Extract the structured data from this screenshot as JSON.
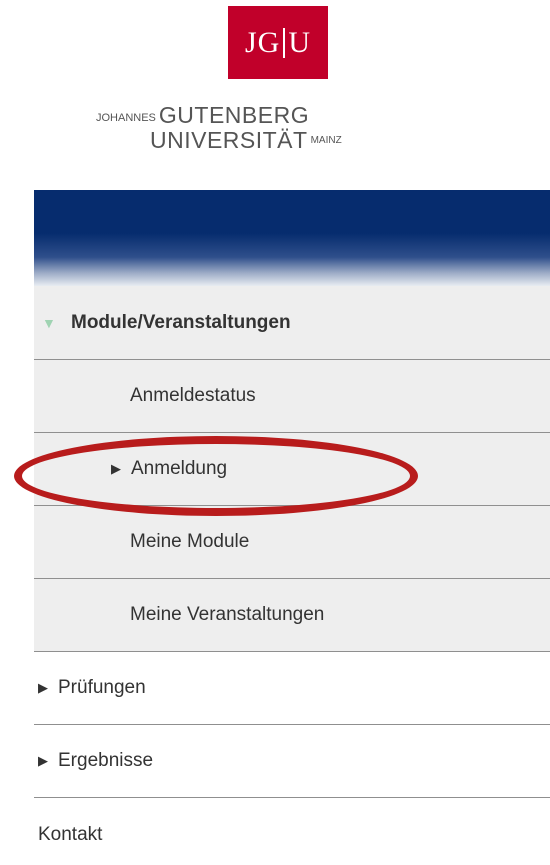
{
  "logo": {
    "mark_left": "JG",
    "mark_right": "U",
    "line1_prefix": "JOHANNES",
    "line1_main": "GUTENBERG",
    "line2_main": "UNIVERSITÄT",
    "line2_suffix": "MAINZ",
    "brand_color": "#c1002a"
  },
  "banner": {
    "color": "#062c6e"
  },
  "menu": {
    "section_title": "Module/Veranstaltungen",
    "section_icon": "triangle-down-icon",
    "sub_items": [
      {
        "label": "Anmeldestatus"
      },
      {
        "label": "Anmeldung",
        "icon": "triangle-right-icon",
        "highlighted": true
      },
      {
        "label": "Meine Module"
      },
      {
        "label": "Meine Veranstaltungen"
      }
    ],
    "top_items": [
      {
        "label": "Prüfungen",
        "icon": "triangle-right-icon"
      },
      {
        "label": "Ergebnisse",
        "icon": "triangle-right-icon"
      },
      {
        "label": "Kontakt"
      }
    ]
  },
  "annotation": {
    "color": "#b81c1c"
  }
}
